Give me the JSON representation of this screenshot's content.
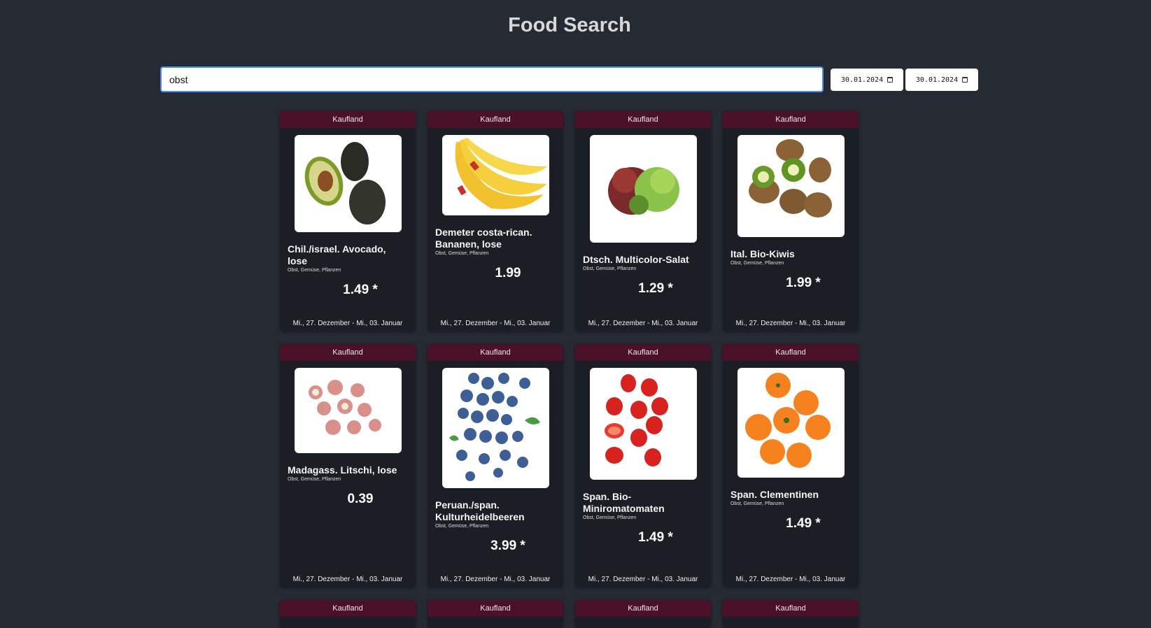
{
  "page": {
    "title": "Food Search"
  },
  "search": {
    "value": "obst"
  },
  "dates": {
    "from": "30.01.2024",
    "to": "30.01.2024"
  },
  "products": [
    {
      "store": "Kaufland",
      "name": "Chil./israel. Avocado, lose",
      "category": "Obst, Gemüse, Pflanzen",
      "price": "1.49 *",
      "valid": "Mi., 27. Dezember - Mi., 03. Januar",
      "image": "avocado"
    },
    {
      "store": "Kaufland",
      "name": "Demeter costa-rican. Bananen, lose",
      "category": "Obst, Gemüse, Pflanzen",
      "price": "1.99",
      "valid": "Mi., 27. Dezember - Mi., 03. Januar",
      "image": "bananas"
    },
    {
      "store": "Kaufland",
      "name": "Dtsch. Multicolor-Salat",
      "category": "Obst, Gemüse, Pflanzen",
      "price": "1.29 *",
      "valid": "Mi., 27. Dezember - Mi., 03. Januar",
      "image": "lettuce"
    },
    {
      "store": "Kaufland",
      "name": "Ital. Bio-Kiwis",
      "category": "Obst, Gemüse, Pflanzen",
      "price": "1.99 *",
      "valid": "Mi., 27. Dezember - Mi., 03. Januar",
      "image": "kiwis"
    },
    {
      "store": "Kaufland",
      "name": "Madagass. Litschi, lose",
      "category": "Obst, Gemüse, Pflanzen",
      "price": "0.39",
      "valid": "Mi., 27. Dezember - Mi., 03. Januar",
      "image": "lychee"
    },
    {
      "store": "Kaufland",
      "name": "Peruan./span. Kulturheidelbeeren",
      "category": "Obst, Gemüse, Pflanzen",
      "price": "3.99 *",
      "valid": "Mi., 27. Dezember - Mi., 03. Januar",
      "image": "blueberries"
    },
    {
      "store": "Kaufland",
      "name": "Span. Bio-Miniromatomaten",
      "category": "Obst, Gemüse, Pflanzen",
      "price": "1.49 *",
      "valid": "Mi., 27. Dezember - Mi., 03. Januar",
      "image": "tomatoes"
    },
    {
      "store": "Kaufland",
      "name": "Span. Clementinen",
      "category": "Obst, Gemüse, Pflanzen",
      "price": "1.49 *",
      "valid": "Mi., 27. Dezember - Mi., 03. Januar",
      "image": "clementines"
    },
    {
      "store": "Kaufland"
    },
    {
      "store": "Kaufland"
    },
    {
      "store": "Kaufland"
    },
    {
      "store": "Kaufland"
    }
  ],
  "colors": {
    "background": "#262a33",
    "card": "#1b1e24",
    "card_header": "#4a1128",
    "focus": "#4b8df5"
  }
}
